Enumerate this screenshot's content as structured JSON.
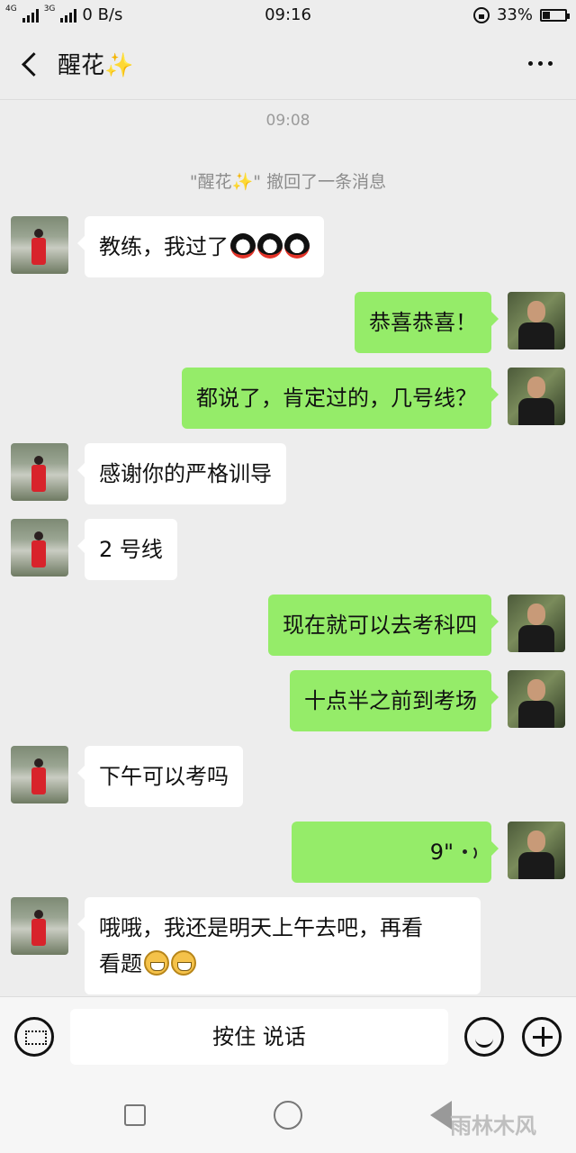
{
  "status": {
    "network1": "4G",
    "network2": "3G",
    "speed": "0 B/s",
    "time": "09:16",
    "battery": "33%",
    "battery_level": 0.33
  },
  "header": {
    "title": "醒花✨"
  },
  "chat": {
    "timestamp": "09:08",
    "system_notice": "\"醒花✨\" 撤回了一条消息",
    "messages": [
      {
        "side": "in",
        "text": "教练，我过了",
        "emoji": "penguin x3"
      },
      {
        "side": "out",
        "text": "恭喜恭喜！"
      },
      {
        "side": "out",
        "text": "都说了，肯定过的，几号线？"
      },
      {
        "side": "in",
        "text": "感谢你的严格训导"
      },
      {
        "side": "in",
        "text": "2 号线"
      },
      {
        "side": "out",
        "text": "现在就可以去考科四"
      },
      {
        "side": "out",
        "text": "十点半之前到考场"
      },
      {
        "side": "in",
        "text": "下午可以考吗"
      },
      {
        "side": "out",
        "type": "voice",
        "duration": "9\""
      },
      {
        "side": "in",
        "text_line1": "哦哦，我还是明天上午去吧，再看",
        "text_line2": "看题",
        "emoji": "grin x2"
      }
    ]
  },
  "input": {
    "hold_to_talk": "按住 说话"
  },
  "watermark": "雨林木风"
}
